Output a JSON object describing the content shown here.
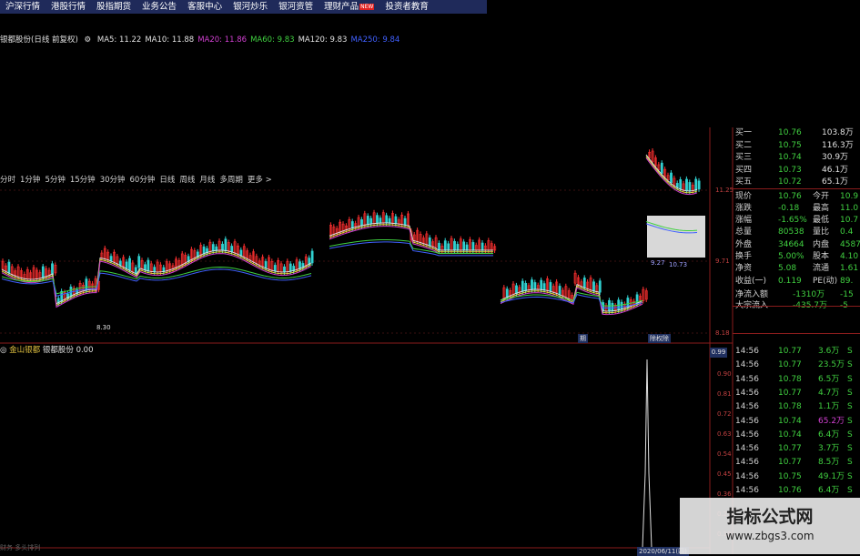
{
  "menu": [
    {
      "label": "沪深行情",
      "new": false
    },
    {
      "label": "港股行情",
      "new": false
    },
    {
      "label": "股指期货",
      "new": false
    },
    {
      "label": "业务公告",
      "new": false
    },
    {
      "label": "客服中心",
      "new": false
    },
    {
      "label": "银河炒乐",
      "new": false
    },
    {
      "label": "银河资管",
      "new": false
    },
    {
      "label": "理财产品",
      "new": true
    },
    {
      "label": "投资者教育",
      "new": false
    }
  ],
  "menu_new_badge": "NEW",
  "ma_line": {
    "stock": "银都股份(日线 前复权)",
    "items": [
      {
        "text": "MA5: 11.22",
        "color": "#e0e0e0"
      },
      {
        "text": "MA10: 11.88",
        "color": "#e0e0e0"
      },
      {
        "text": "MA20: 11.86",
        "color": "#d040d0"
      },
      {
        "text": "MA60: 9.83",
        "color": "#40d040"
      },
      {
        "text": "MA120: 9.83",
        "color": "#e0e0e0"
      },
      {
        "text": "MA250: 9.84",
        "color": "#4060ff"
      }
    ]
  },
  "periods": [
    "分时",
    "1分钟",
    "5分钟",
    "15分钟",
    "30分钟",
    "60分钟",
    "日线",
    "周线",
    "月线",
    "多周期",
    "更多 >"
  ],
  "price_axis": {
    "top": "11.25",
    "mid": "9.71",
    "low": "8.18"
  },
  "chart_labels": {
    "low_price": "8.30",
    "ann1": "9.27",
    "ann2": "10.73",
    "mark1": "期",
    "mark2": "除权除"
  },
  "indicator_line": {
    "name": "金山银都",
    "stock": "银都股份",
    "value": "0.00"
  },
  "ind_axis": {
    "top": "0.99",
    "ticks": [
      "0.99",
      "0.90",
      "0.81",
      "0.72",
      "0.63",
      "0.54",
      "0.45",
      "0.36",
      "0.27",
      "0.18"
    ]
  },
  "bottom_date": "2020/06/11(四)",
  "bottom_left": "财务 多头排列",
  "orderbook": [
    {
      "label": "买一",
      "price": "10.76",
      "vol": "103.8万"
    },
    {
      "label": "买二",
      "price": "10.75",
      "vol": "116.3万"
    },
    {
      "label": "买三",
      "price": "10.74",
      "vol": "30.9万"
    },
    {
      "label": "买四",
      "price": "10.73",
      "vol": "46.1万"
    },
    {
      "label": "买五",
      "price": "10.72",
      "vol": "65.1万"
    }
  ],
  "quote": [
    {
      "l1": "现价",
      "v1": "10.76",
      "l2": "今开",
      "v2": "10.9"
    },
    {
      "l1": "涨跌",
      "v1": "-0.18",
      "l2": "最高",
      "v2": "11.0"
    },
    {
      "l1": "涨幅",
      "v1": "-1.65%",
      "l2": "最低",
      "v2": "10.7"
    },
    {
      "l1": "总量",
      "v1": "80538",
      "l2": "量比",
      "v2": "0.4"
    },
    {
      "l1": "外盘",
      "v1": "34664",
      "l2": "内盘",
      "v2": "4587"
    },
    {
      "l1": "换手",
      "v1": "5.00%",
      "l2": "股本",
      "v2": "4.10"
    },
    {
      "l1": "净资",
      "v1": "5.08",
      "l2": "流通",
      "v2": "1.61"
    },
    {
      "l1": "收益(一)",
      "v1": "0.119",
      "l2": "PE(动)",
      "v2": "89."
    }
  ],
  "flows": [
    {
      "label": "净流入额",
      "v1": "-1310万",
      "v2": "-15"
    },
    {
      "label": "大宗流入",
      "v1": "-435.7万",
      "v2": "-5"
    }
  ],
  "ticks": [
    {
      "time": "14:56",
      "price": "10.77",
      "vol": "3.6万",
      "side": "S"
    },
    {
      "time": "14:56",
      "price": "10.77",
      "vol": "23.5万",
      "side": "S"
    },
    {
      "time": "14:56",
      "price": "10.78",
      "vol": "6.5万",
      "side": "S"
    },
    {
      "time": "14:56",
      "price": "10.77",
      "vol": "4.7万",
      "side": "S"
    },
    {
      "time": "14:56",
      "price": "10.78",
      "vol": "1.1万",
      "side": "S"
    },
    {
      "time": "14:56",
      "price": "10.74",
      "vol": "65.2万",
      "side": "S"
    },
    {
      "time": "14:56",
      "price": "10.74",
      "vol": "6.4万",
      "side": "S"
    },
    {
      "time": "14:56",
      "price": "10.77",
      "vol": "3.7万",
      "side": "S"
    },
    {
      "time": "14:56",
      "price": "10.77",
      "vol": "8.5万",
      "side": "S"
    },
    {
      "time": "14:56",
      "price": "10.75",
      "vol": "49.1万",
      "side": "S"
    },
    {
      "time": "14:56",
      "price": "10.76",
      "vol": "6.4万",
      "side": "S"
    }
  ],
  "watermark": {
    "title": "指标公式网",
    "url": "www.zbgs3.com"
  }
}
